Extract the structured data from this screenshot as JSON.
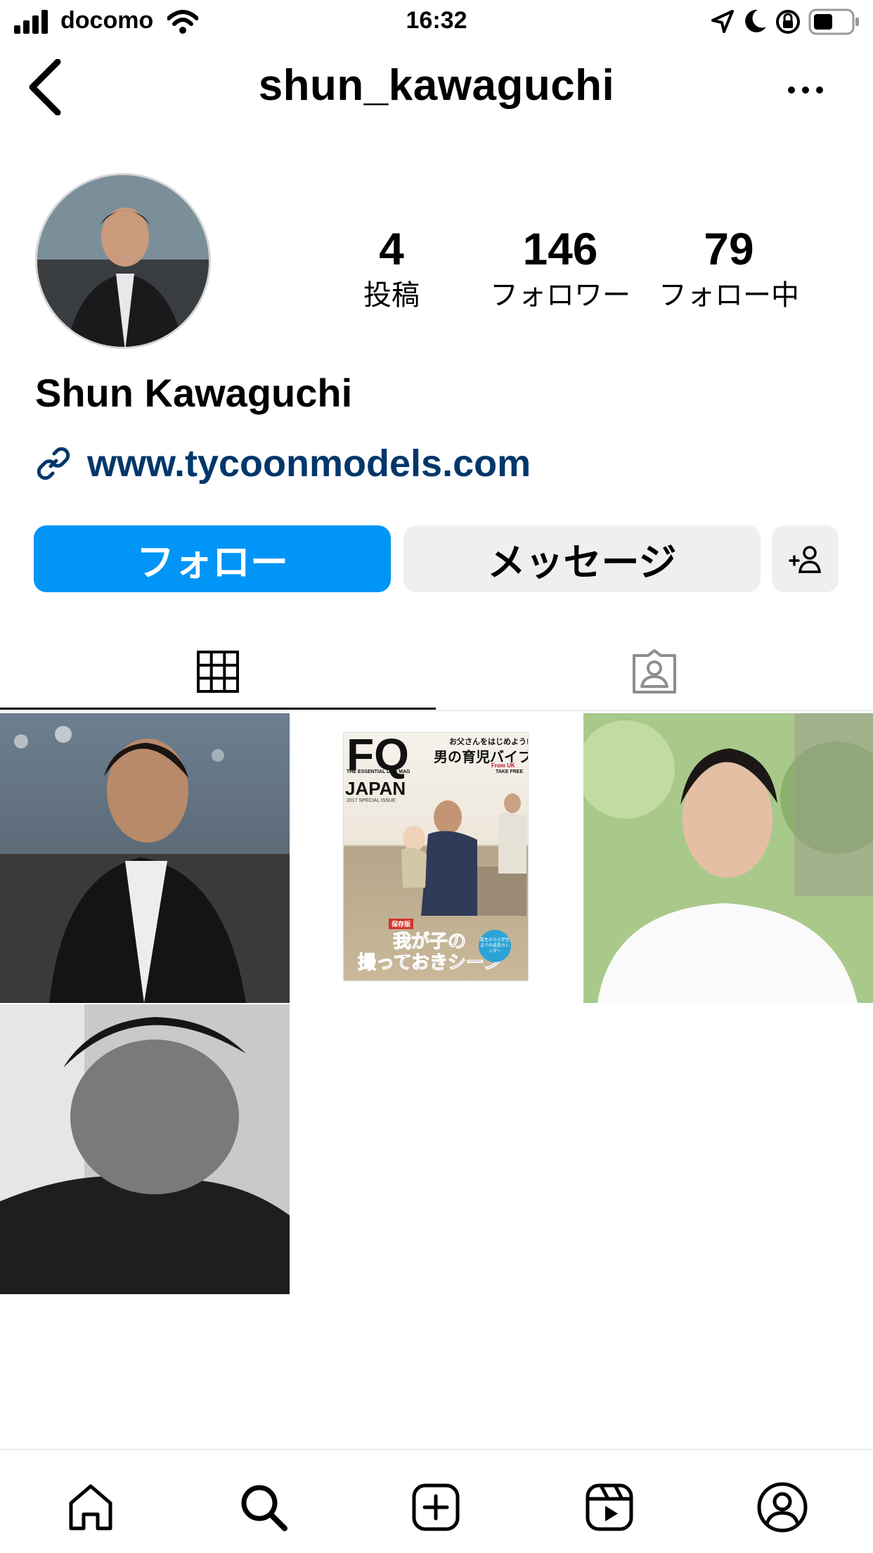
{
  "status_bar": {
    "carrier": "docomo",
    "time": "16:32"
  },
  "header": {
    "username": "shun_kawaguchi"
  },
  "profile": {
    "stats": [
      {
        "value": "4",
        "label": "投稿"
      },
      {
        "value": "146",
        "label": "フォロワー"
      },
      {
        "value": "79",
        "label": "フォロー中"
      }
    ],
    "full_name": "Shun Kawaguchi",
    "website": "www.tycoonmodels.com"
  },
  "actions": {
    "follow_label": "フォロー",
    "message_label": "メッセージ"
  },
  "magazine": {
    "brand": "FQ",
    "country": "JAPAN",
    "tagline": "THE ESSENTIAL DAD MAG",
    "issue": "2017 SPECIAL ISSUE",
    "headline": "お父さんをはじめよう!",
    "subhead": "男の育児バイブル",
    "from_uk": "From UK",
    "take_free": "TAKE FREE",
    "badge": "保存版",
    "cover_line1": "我が子の",
    "cover_line2": "撮っておきシーン",
    "circle_text": "誕生から小学生までの成長カレンダー"
  },
  "colors": {
    "accent_blue": "#0095f6",
    "link_blue": "#00376b",
    "button_gray": "#efefef"
  },
  "icons": {
    "back": "back-chevron-icon",
    "more": "more-dots-icon",
    "grid": "grid-icon",
    "tagged": "tagged-icon",
    "home": "home-icon",
    "search": "search-icon",
    "create": "create-icon",
    "reels": "reels-icon",
    "profile": "profile-icon"
  }
}
